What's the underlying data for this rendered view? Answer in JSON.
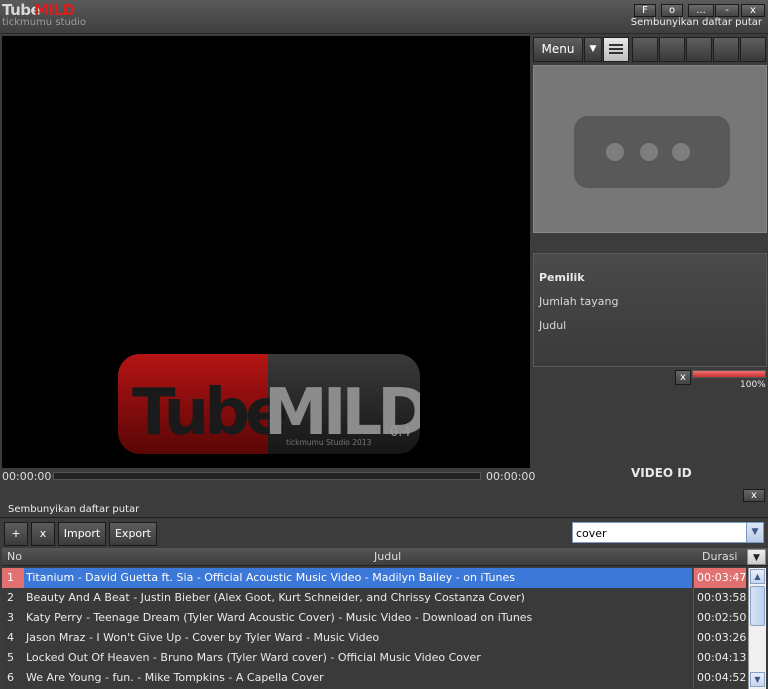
{
  "app": {
    "logo_main": "Tube",
    "logo_accent": "MILD",
    "logo_sub": "tickmumu studio"
  },
  "window_buttons": [
    {
      "label": "F"
    },
    {
      "label": "o"
    },
    {
      "label": "..."
    },
    {
      "label": "-"
    },
    {
      "label": "x"
    }
  ],
  "hide_playlist_label": "Sembunyikan daftar putar",
  "player": {
    "splash_text_main": "Tube",
    "splash_text_accent": "MILD",
    "splash_version": "0.4",
    "splash_credit": "tickmumu Studio 2013",
    "time_elapsed": "00:00:00",
    "time_total": "00:00:00",
    "progress": 0
  },
  "side": {
    "menu_label": "Menu",
    "dropdown_glyph": "▼",
    "info": {
      "owner_label": "Pemilik",
      "views_label": "Jumlah tayang",
      "title_label": "Judul"
    },
    "volume": {
      "mute_label": "x",
      "percent": 100,
      "percent_label": "100%"
    },
    "video_id_label": "VIDEO ID"
  },
  "playlist": {
    "close_label": "x",
    "add_label": "+",
    "remove_label": "x",
    "import_label": "Import",
    "export_label": "Export",
    "search_value": "cover",
    "columns": {
      "no": "No",
      "title": "Judul",
      "duration": "Durasi"
    },
    "rows": [
      {
        "no": "1",
        "title": "Titanium - David Guetta ft. Sia - Official Acoustic Music Video - Madilyn Bailey - on iTunes",
        "duration": "00:03:47",
        "selected": true
      },
      {
        "no": "2",
        "title": "Beauty And A Beat - Justin Bieber (Alex Goot, Kurt Schneider, and Chrissy Costanza Cover)",
        "duration": "00:03:58",
        "selected": false
      },
      {
        "no": "3",
        "title": "Katy Perry - Teenage Dream (Tyler Ward Acoustic Cover) - Music Video - Download on iTunes",
        "duration": "00:02:50",
        "selected": false
      },
      {
        "no": "4",
        "title": "Jason Mraz - I Won't Give Up - Cover by Tyler Ward - Music Video",
        "duration": "00:03:26",
        "selected": false
      },
      {
        "no": "5",
        "title": "Locked Out Of Heaven - Bruno Mars (Tyler Ward cover) - Official Music Video Cover",
        "duration": "00:04:13",
        "selected": false
      },
      {
        "no": "6",
        "title": "We Are Young - fun. - Mike Tompkins - A Capella Cover",
        "duration": "00:04:52",
        "selected": false
      }
    ]
  },
  "colors": {
    "logo_red": "#d42020",
    "selection_blue": "#3c78d8",
    "selection_red": "#e27070"
  }
}
